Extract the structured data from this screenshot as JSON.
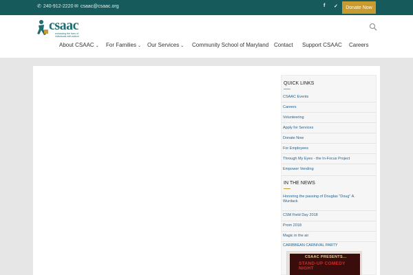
{
  "topbar": {
    "phone": "240-912-2220",
    "email": "csaac@csaac.org",
    "donate_label": "Donate Now"
  },
  "logo": {
    "name": "csaac",
    "tagline": "enhancing the lives of individuals with autism"
  },
  "nav": [
    {
      "label": "About CSAAC",
      "dropdown": true
    },
    {
      "label": "For Families",
      "dropdown": true
    },
    {
      "label": "Our Services",
      "dropdown": true
    },
    {
      "label": "Community School of Maryland",
      "dropdown": false
    },
    {
      "label": "Contact",
      "dropdown": false
    },
    {
      "label": "Support CSAAC",
      "dropdown": false
    },
    {
      "label": "Careers",
      "dropdown": false
    }
  ],
  "sidebar": {
    "quick_links_title": "QUICK LINKS",
    "quick_links": [
      "CSAAC Events",
      "Careers",
      "Volunteering",
      "Apply for Services",
      "Donate Now",
      "For Employees",
      "Through My Eyes - the In-Focus Project",
      "Empower Vending"
    ],
    "news_title": "IN THE NEWS",
    "news": [
      "Honoring the passing of Douglas \"Doug\" A. Wurdack",
      "CSM Field Day 2018",
      "Prom 2018",
      "Magic in the air",
      "CARIBBEAN CARNIVAL PARTY"
    ],
    "poster": {
      "line1": "CSAAC PRESENTS...",
      "line2": "STAND-UP COMEDY NIGHT"
    }
  },
  "colors": {
    "topbar": "#165a5c",
    "accent": "#c99a2e",
    "link": "#1f5f8a",
    "brand": "#1f6e72"
  }
}
